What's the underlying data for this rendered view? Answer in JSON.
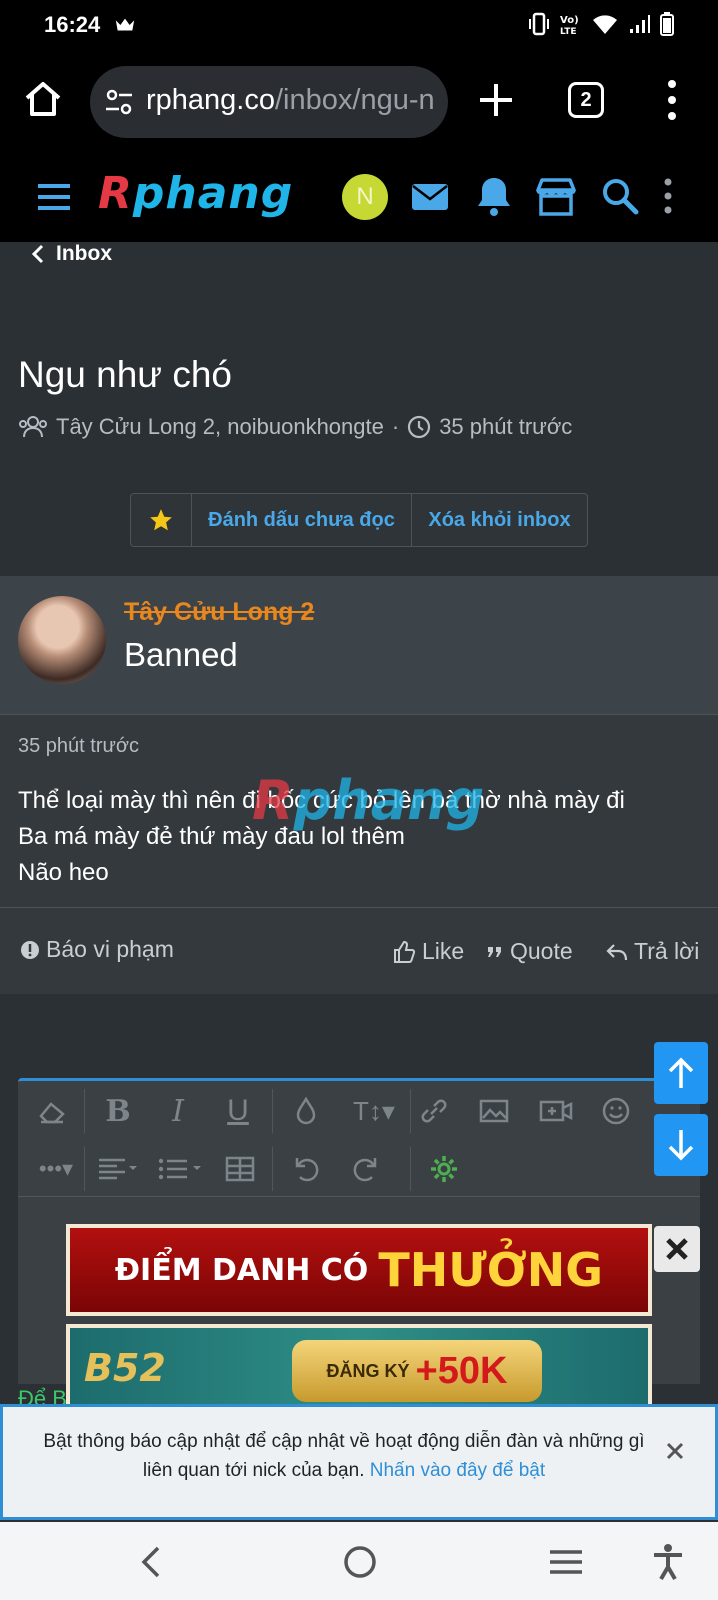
{
  "status_bar": {
    "time": "16:24"
  },
  "browser": {
    "url_host": "rphang.co",
    "url_path": "/inbox/ngu-n",
    "tab_count": "2"
  },
  "site": {
    "logo_first": "R",
    "logo_rest": "phang",
    "avatar_initial": "N"
  },
  "breadcrumb": {
    "label": "Inbox"
  },
  "conversation": {
    "title": "Ngu như chó",
    "participants": "Tây Cửu Long 2, noibuonkhongte",
    "separator": "·",
    "time_ago": "35 phút trước",
    "buttons": {
      "mark_unread": "Đánh dấu chưa đọc",
      "remove": "Xóa khỏi inbox"
    }
  },
  "message": {
    "author": "Tây Cửu Long 2",
    "role": "Banned",
    "time": "35 phút trước",
    "lines": [
      "Thể loại mày thì nên đi bốc cức bỏ lên bà thờ nhà mày đi",
      "Ba má mày đẻ thứ mày đau lol thêm",
      "Não heo"
    ],
    "watermark_first": "R",
    "watermark_rest": "phang",
    "actions": {
      "report": "Báo vi phạm",
      "like": "Like",
      "quote": "Quote",
      "reply": "Trả lời"
    }
  },
  "ads": {
    "banner1_white": "ĐIỂM DANH CÓ",
    "banner1_gold": "THƯỞNG",
    "banner2_brand": "B52",
    "banner2_small": "ĐĂNG KÝ",
    "banner2_big": "+50K"
  },
  "editor_peek": "Để B",
  "notification": {
    "text": "Bật thông báo cập nhật để cập nhật về hoạt động diễn đàn và những gì liên quan tới nick của bạn.",
    "link": "Nhấn vào đây để bật"
  },
  "colors": {
    "accent": "#2196f3",
    "link": "#4aa8e8",
    "banned_author": "#e8871e",
    "background": "#2b3034"
  }
}
